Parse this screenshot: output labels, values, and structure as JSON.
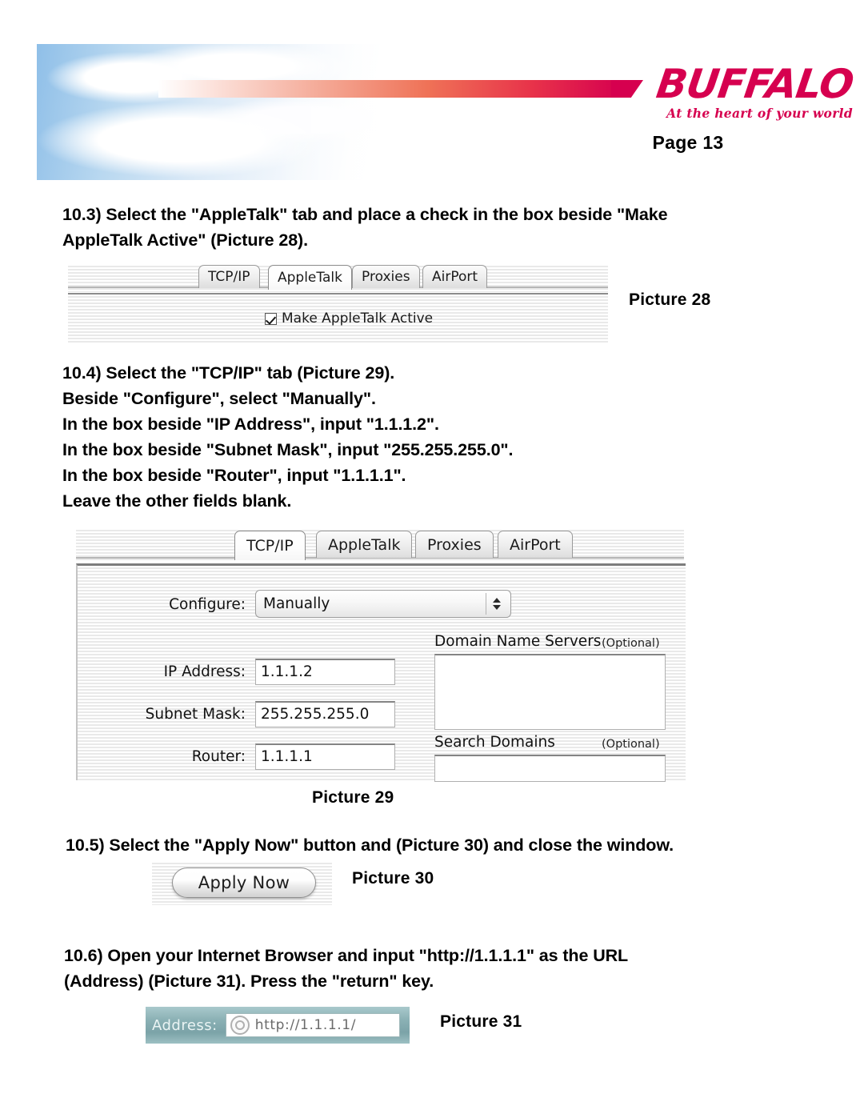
{
  "header": {
    "logo_word": "BUFFALO",
    "logo_tagline": "At the heart of your world",
    "page_label": "Page 13",
    "brand_color": "#d6004f",
    "sky_color": "#8fbfe8"
  },
  "steps": {
    "s103": "10.3)  Select the \"AppleTalk\" tab and place a check in the box beside \"Make\nAppleTalk Active\" (Picture 28).",
    "s104": "10.4) Select the \"TCP/IP\" tab (Picture 29).\nBeside \"Configure\", select \"Manually\".\nIn the box beside \"IP Address\", input \"1.1.1.2\".\nIn the box beside \"Subnet Mask\", input \"255.255.255.0\".\nIn the box beside \"Router\", input \"1.1.1.1\".\nLeave the other fields blank.",
    "s105": "10.5)  Select the \"Apply Now\" button and (Picture 30) and close the window.",
    "s106": "10.6)  Open your Internet Browser and input \"http://1.1.1.1\" as the URL\n(Address) (Picture 31).  Press the \"return\" key."
  },
  "captions": {
    "c28": "Picture  28",
    "c29": "Picture  29",
    "c30": "Picture 30",
    "c31": "Picture 31"
  },
  "picture28": {
    "tabs": [
      {
        "label": "TCP/IP",
        "active": false
      },
      {
        "label": "AppleTalk",
        "active": true
      },
      {
        "label": "Proxies",
        "active": false
      },
      {
        "label": "AirPort",
        "active": false
      }
    ],
    "checkbox_label": "Make AppleTalk Active",
    "checkbox_checked": true
  },
  "picture29": {
    "tabs": [
      {
        "label": "TCP/IP",
        "active": true
      },
      {
        "label": "AppleTalk",
        "active": false
      },
      {
        "label": "Proxies",
        "active": false
      },
      {
        "label": "AirPort",
        "active": false
      }
    ],
    "configure_label": "Configure:",
    "configure_value": "Manually",
    "fields": [
      {
        "label": "IP Address:",
        "value": "1.1.1.2"
      },
      {
        "label": "Subnet Mask:",
        "value": "255.255.255.0"
      },
      {
        "label": "Router:",
        "value": "1.1.1.1"
      }
    ],
    "dns_title": "Domain Name Servers",
    "dns_optional": "(Optional)",
    "dns_value": "",
    "search_title": "Search Domains",
    "search_optional": "(Optional)",
    "search_value": ""
  },
  "picture30": {
    "button_label": "Apply Now"
  },
  "picture31": {
    "address_label": "Address:",
    "url_value": "http://1.1.1.1/",
    "bar_color": "#7ba3a8"
  }
}
